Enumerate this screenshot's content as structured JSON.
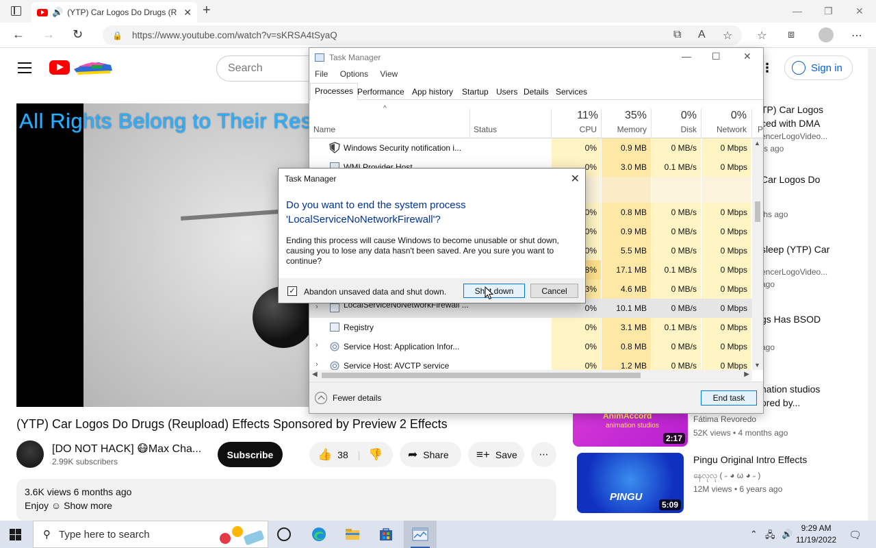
{
  "browser": {
    "tab_title": "(YTP) Car Logos Do Drugs (R",
    "url": "https://www.youtube.com/watch?v=sKRSA4tSyaQ"
  },
  "youtube": {
    "search_placeholder": "Search",
    "signin_label": "Sign in",
    "player_overlay_text": "All Rights Belong to Their Respe",
    "video_title": "(YTP) Car Logos Do Drugs (Reupload) Effects Sponsored by Preview 2 Effects",
    "channel_name": "[DO NOT HACK] 😷Max Cha...",
    "subscribers": "2.99K subscribers",
    "subscribe_label": "Subscribe",
    "like_count": "38",
    "share_label": "Share",
    "save_label": "Save",
    "views_and_date": "3.6K views  6 months ago",
    "desc_text": "Enjoy ☺",
    "show_more": "Show more"
  },
  "sidebar": [
    {
      "line1": "TP) Car Logos",
      "line2": "ced with DMA",
      "sub1": "encerLogoVideo...",
      "sub2": "rs ago"
    },
    {
      "line1": "Car Logos Do",
      "line2": ".",
      "sub1": "",
      "sub2": "ths ago"
    },
    {
      "line1": "sleep (YTP) Car",
      "line2": "",
      "sub1": "encerLogoVideo...",
      "sub2": "ago"
    },
    {
      "line1": "gs Has BSOD",
      "line2": "",
      "sub1": "",
      "sub2": "ago"
    },
    {
      "line1": "nation studios",
      "line2": "ored by...",
      "sub1": "",
      "sub2": ""
    }
  ],
  "recommendations": [
    {
      "channel": "Fátima Revoredo",
      "meta": "52K views  •  4 months ago",
      "duration": "2:17",
      "thumb_text1": "AnimAccord",
      "thumb_text2": "animation studios"
    },
    {
      "title": "Pingu Original Intro Effects",
      "channel": "နေလုလု ( ˶ ◕ ω ◕ ˶ )",
      "meta": "12M views  •  6 years ago",
      "duration": "5:09",
      "thumb_text1": "PINGU"
    }
  ],
  "task_manager": {
    "title": "Task Manager",
    "menu": [
      "File",
      "Options",
      "View"
    ],
    "tabs": [
      "Processes",
      "Performance",
      "App history",
      "Startup",
      "Users",
      "Details",
      "Services"
    ],
    "active_tab": "Processes",
    "columns": {
      "name": "Name",
      "status": "Status",
      "cpu_pct": "11%",
      "cpu": "CPU",
      "mem_pct": "35%",
      "mem": "Memory",
      "disk_pct": "0%",
      "disk": "Disk",
      "net_pct": "0%",
      "net": "Network",
      "power": "P"
    },
    "rows": [
      {
        "name": "Windows Security notification i...",
        "cpu": "0%",
        "mem": "0.9 MB",
        "disk": "0 MB/s",
        "net": "0 Mbps"
      },
      {
        "name": "WMI Provider Host",
        "cpu": "0%",
        "mem": "3.0 MB",
        "disk": "0.1 MB/s",
        "net": "0 Mbps"
      },
      {
        "name": "",
        "cpu": "",
        "mem": "",
        "disk": "",
        "net": ""
      },
      {
        "name": "",
        "cpu": "0%",
        "mem": "0.8 MB",
        "disk": "0 MB/s",
        "net": "0 Mbps"
      },
      {
        "name": "",
        "cpu": "0%",
        "mem": "0.9 MB",
        "disk": "0 MB/s",
        "net": "0 Mbps"
      },
      {
        "name": "",
        "cpu": "0%",
        "mem": "5.5 MB",
        "disk": "0 MB/s",
        "net": "0 Mbps"
      },
      {
        "name": "",
        "cpu": "8%",
        "mem": "17.1 MB",
        "disk": "0.1 MB/s",
        "net": "0 Mbps"
      },
      {
        "name": "",
        "cpu": "3%",
        "mem": "4.6 MB",
        "disk": "0 MB/s",
        "net": "0 Mbps"
      },
      {
        "name": "LocalServiceNoNetworkFirewall ...",
        "cpu": "0%",
        "mem": "10.1 MB",
        "disk": "0 MB/s",
        "net": "0 Mbps"
      },
      {
        "name": "Registry",
        "cpu": "0%",
        "mem": "3.1 MB",
        "disk": "0.1 MB/s",
        "net": "0 Mbps"
      },
      {
        "name": "Service Host: Application Infor...",
        "cpu": "0%",
        "mem": "0.8 MB",
        "disk": "0 MB/s",
        "net": "0 Mbps"
      },
      {
        "name": "Service Host: AVCTP service",
        "cpu": "0%",
        "mem": "1.2 MB",
        "disk": "0 MB/s",
        "net": "0 Mbps"
      }
    ],
    "fewer_details": "Fewer details",
    "end_task": "End task"
  },
  "dialog": {
    "title": "Task Manager",
    "question_line1": "Do you want to end the system process",
    "question_line2": "'LocalServiceNoNetworkFirewall'?",
    "body": "Ending this process will cause Windows to become unusable or shut down, causing you to lose any data hasn't been saved. Are you sure you want to continue?",
    "checkbox_label": "Abandon unsaved data and shut down.",
    "checkbox_checked": true,
    "shutdown_label": "Shut down",
    "cancel_label": "Cancel"
  },
  "taskbar": {
    "search_placeholder": "Type here to search",
    "time": "9:29 AM",
    "date": "11/19/2022"
  }
}
